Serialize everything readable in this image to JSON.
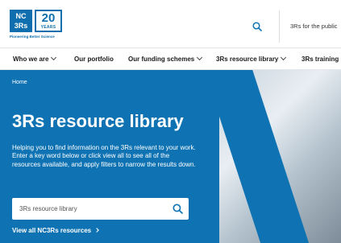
{
  "header": {
    "logo": {
      "line1": "NC",
      "line2": "3Rs",
      "years_number": "20",
      "years_label": "YEARS",
      "tagline": "Pioneering Better Science"
    },
    "search_icon": "search-icon",
    "for_public_label": "3Rs for the public"
  },
  "nav": {
    "items": [
      {
        "label": "Who we are",
        "has_dropdown": true
      },
      {
        "label": "Our portfolio",
        "has_dropdown": false
      },
      {
        "label": "Our funding schemes",
        "has_dropdown": true
      },
      {
        "label": "3Rs resource library",
        "has_dropdown": true
      },
      {
        "label": "3Rs training",
        "has_dropdown": false
      }
    ]
  },
  "hero": {
    "breadcrumb": "Home",
    "title": "3Rs resource library",
    "intro": "Helping you to find information on the 3Rs relevant to your work. Enter a key word below or click view all to see all of the resources available, and apply filters to narrow the results down.",
    "search": {
      "placeholder": "3Rs resource library",
      "value": ""
    },
    "view_all_label": "View all NC3Rs resources"
  },
  "colors": {
    "brand_blue": "#0f73b3",
    "logo_blue": "#0f6fae"
  }
}
